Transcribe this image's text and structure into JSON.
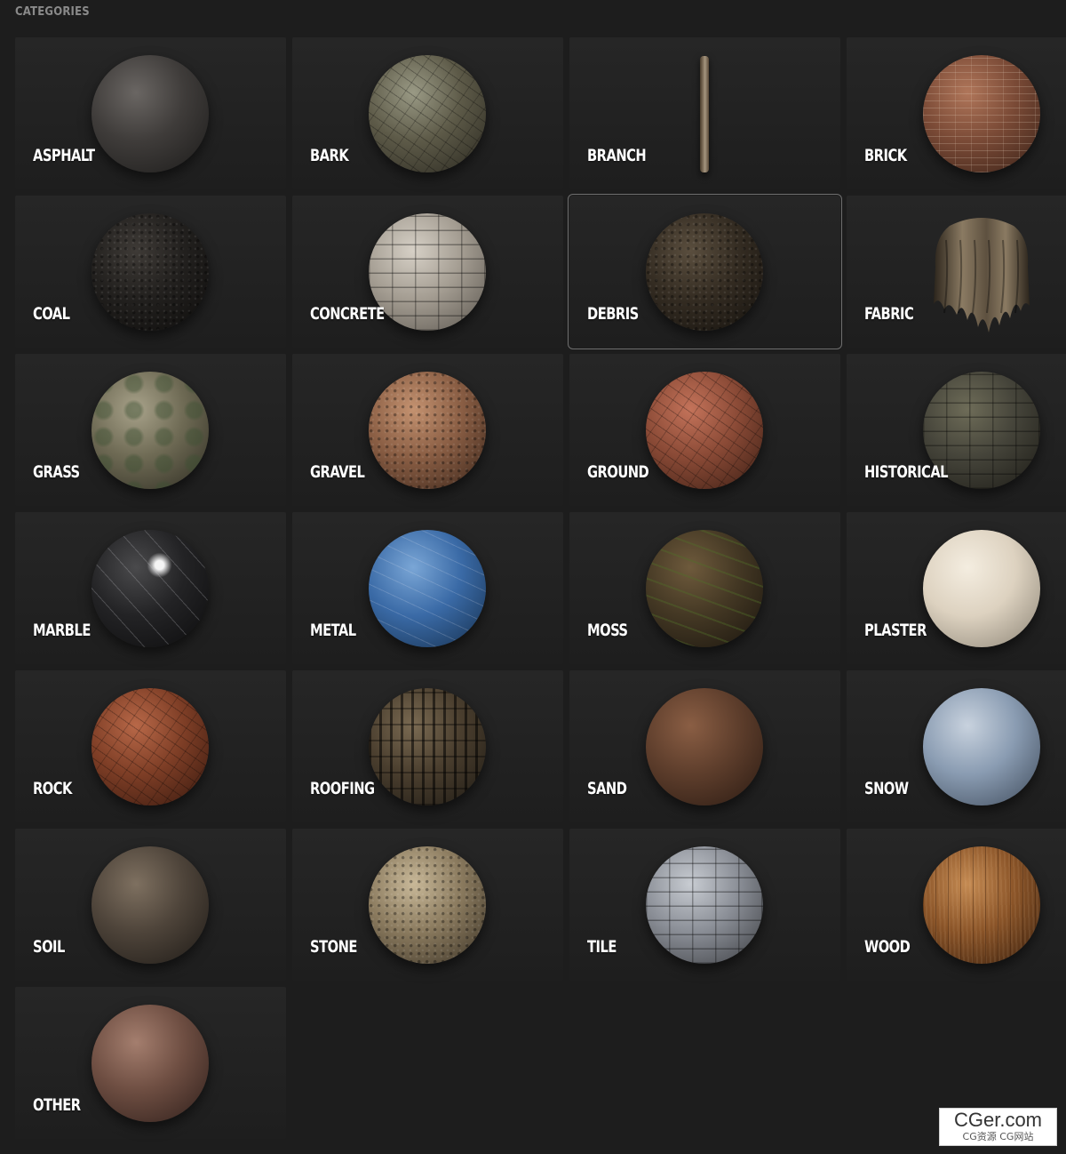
{
  "section": {
    "title": "CATEGORIES"
  },
  "selected": "DEBRIS",
  "categories": [
    {
      "label": "ASPHALT",
      "icon": "asphalt-sphere-icon",
      "colors": [
        "#6a6663",
        "#3f3c3a",
        "#1c1b1a"
      ],
      "texture": "none"
    },
    {
      "label": "BARK",
      "icon": "bark-sphere-icon",
      "colors": [
        "#9a9a85",
        "#5d5a48",
        "#2a2820"
      ],
      "texture": "cracks"
    },
    {
      "label": "BRANCH",
      "icon": "branch-icon",
      "colors": [
        "#a59680",
        "#6a5a46",
        "#3a2e22"
      ],
      "texture": "branch"
    },
    {
      "label": "BRICK",
      "icon": "brick-sphere-icon",
      "colors": [
        "#b0765a",
        "#7a4a36",
        "#3a2218"
      ],
      "texture": "bricks"
    },
    {
      "label": "COAL",
      "icon": "coal-sphere-icon",
      "colors": [
        "#3e3a36",
        "#22201e",
        "#0e0d0c"
      ],
      "texture": "speckle"
    },
    {
      "label": "CONCRETE",
      "icon": "concrete-sphere-icon",
      "colors": [
        "#d6d0c6",
        "#a49d92",
        "#5a554e"
      ],
      "texture": "blocks"
    },
    {
      "label": "DEBRIS",
      "icon": "debris-sphere-icon",
      "colors": [
        "#5a4e3e",
        "#342c22",
        "#15120e"
      ],
      "texture": "speckle"
    },
    {
      "label": "FABRIC",
      "icon": "fabric-cloth-icon",
      "colors": [
        "#8a7a62",
        "#5e5140",
        "#2c251c"
      ],
      "texture": "cloth"
    },
    {
      "label": "GRASS",
      "icon": "grass-sphere-icon",
      "colors": [
        "#a8a28a",
        "#6e6a54",
        "#2e2c22"
      ],
      "texture": "patches"
    },
    {
      "label": "GRAVEL",
      "icon": "gravel-sphere-icon",
      "colors": [
        "#c49270",
        "#8a5e44",
        "#3a251a"
      ],
      "texture": "speckle"
    },
    {
      "label": "GROUND",
      "icon": "ground-sphere-icon",
      "colors": [
        "#c4735a",
        "#8a4a36",
        "#3a1e14"
      ],
      "texture": "cracks"
    },
    {
      "label": "HISTORICAL",
      "icon": "historical-sphere-icon",
      "colors": [
        "#6e6c58",
        "#45443a",
        "#1c1b16"
      ],
      "texture": "blocks"
    },
    {
      "label": "MARBLE",
      "icon": "marble-sphere-icon",
      "colors": [
        "#4a4a4c",
        "#232325",
        "#0c0c0d"
      ],
      "texture": "marble"
    },
    {
      "label": "METAL",
      "icon": "metal-sphere-icon",
      "colors": [
        "#7aa6d6",
        "#3a6aa6",
        "#16304e"
      ],
      "texture": "scratches"
    },
    {
      "label": "MOSS",
      "icon": "moss-sphere-icon",
      "colors": [
        "#6e5a3c",
        "#443824",
        "#1a150e"
      ],
      "texture": "moss"
    },
    {
      "label": "PLASTER",
      "icon": "plaster-sphere-icon",
      "colors": [
        "#f4ede0",
        "#ddd2c0",
        "#8a8274"
      ],
      "texture": "none"
    },
    {
      "label": "ROCK",
      "icon": "rock-sphere-icon",
      "colors": [
        "#b86848",
        "#7e3e26",
        "#36180e"
      ],
      "texture": "cracks"
    },
    {
      "label": "ROOFING",
      "icon": "roofing-sphere-icon",
      "colors": [
        "#7a6a52",
        "#4a3e2e",
        "#1e1a14"
      ],
      "texture": "roofing"
    },
    {
      "label": "SAND",
      "icon": "sand-sphere-icon",
      "colors": [
        "#8a5e44",
        "#5e3e2c",
        "#2a1a12"
      ],
      "texture": "none"
    },
    {
      "label": "SNOW",
      "icon": "snow-sphere-icon",
      "colors": [
        "#c8d2de",
        "#8a9cb2",
        "#3e4a5a"
      ],
      "texture": "none"
    },
    {
      "label": "SOIL",
      "icon": "soil-sphere-icon",
      "colors": [
        "#7e7060",
        "#4e443a",
        "#1e1a16"
      ],
      "texture": "none"
    },
    {
      "label": "STONE",
      "icon": "stone-sphere-icon",
      "colors": [
        "#c8b898",
        "#8a7a5e",
        "#3a3226"
      ],
      "texture": "speckle"
    },
    {
      "label": "TILE",
      "icon": "tile-sphere-icon",
      "colors": [
        "#c8ccd2",
        "#8a8e96",
        "#3a3c40"
      ],
      "texture": "blocks"
    },
    {
      "label": "WOOD",
      "icon": "wood-sphere-icon",
      "colors": [
        "#c48a52",
        "#8a5428",
        "#3a200e"
      ],
      "texture": "planks"
    },
    {
      "label": "OTHER",
      "icon": "other-sphere-icon",
      "colors": [
        "#a47e6e",
        "#6e4e42",
        "#2e1e1a"
      ],
      "texture": "none"
    }
  ],
  "watermark": {
    "main": "CGer.com",
    "sub": "CG资源 CG网站"
  }
}
